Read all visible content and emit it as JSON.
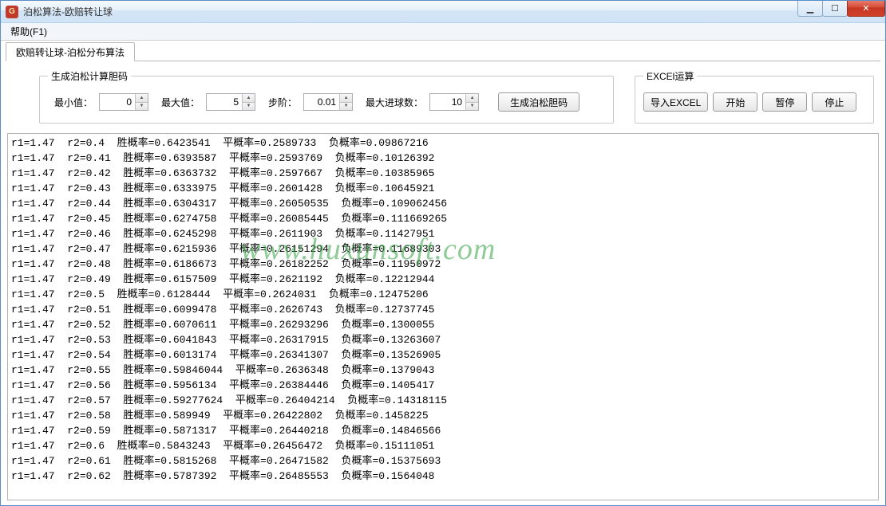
{
  "window": {
    "title": "泊松算法-欧赔转让球",
    "icon_glyph": "G",
    "controls": {
      "minimize": "▁",
      "maximize": "☐",
      "close": "✕"
    }
  },
  "menu": {
    "help": "帮助(F1)"
  },
  "tab": {
    "main": "欧赔转让球-泊松分布算法"
  },
  "gen": {
    "legend": "生成泊松计算胆码",
    "min_label": "最小值：",
    "min_value": "0",
    "max_label": "最大值：",
    "max_value": "5",
    "step_label": "步阶：",
    "step_value": "0.01",
    "maxball_label": "最大进球数：",
    "maxball_value": "10",
    "button": "生成泊松胆码"
  },
  "excel": {
    "legend": "EXCEl运算",
    "import": "导入EXCEL",
    "start": "开始",
    "pause": "暂停",
    "stop": "停止"
  },
  "watermark": "www.huxunsoft.com",
  "chart_data": {
    "type": "table",
    "columns": [
      "r1",
      "r2",
      "胜概率",
      "平概率",
      "负概率"
    ],
    "rows": [
      [
        1.47,
        0.4,
        0.6423541,
        0.2589733,
        0.09867216
      ],
      [
        1.47,
        0.41,
        0.6393587,
        0.2593769,
        0.10126392
      ],
      [
        1.47,
        0.42,
        0.6363732,
        0.2597667,
        0.10385965
      ],
      [
        1.47,
        0.43,
        0.6333975,
        0.2601428,
        0.10645921
      ],
      [
        1.47,
        0.44,
        0.6304317,
        0.26050535,
        0.109062456
      ],
      [
        1.47,
        0.45,
        0.6274758,
        0.26085445,
        0.111669265
      ],
      [
        1.47,
        0.46,
        0.6245298,
        0.2611903,
        0.11427951
      ],
      [
        1.47,
        0.47,
        0.6215936,
        0.26151294,
        0.11689303
      ],
      [
        1.47,
        0.48,
        0.6186673,
        0.26182252,
        0.11950972
      ],
      [
        1.47,
        0.49,
        0.6157509,
        0.2621192,
        0.12212944
      ],
      [
        1.47,
        0.5,
        0.6128444,
        0.2624031,
        0.12475206
      ],
      [
        1.47,
        0.51,
        0.6099478,
        0.2626743,
        0.12737745
      ],
      [
        1.47,
        0.52,
        0.6070611,
        0.26293296,
        0.1300055
      ],
      [
        1.47,
        0.53,
        0.6041843,
        0.26317915,
        0.13263607
      ],
      [
        1.47,
        0.54,
        0.6013174,
        0.26341307,
        0.13526905
      ],
      [
        1.47,
        0.55,
        0.59846044,
        0.2636348,
        0.1379043
      ],
      [
        1.47,
        0.56,
        0.5956134,
        0.26384446,
        0.1405417
      ],
      [
        1.47,
        0.57,
        0.59277624,
        0.26404214,
        0.14318115
      ],
      [
        1.47,
        0.58,
        0.589949,
        0.26422802,
        0.1458225
      ],
      [
        1.47,
        0.59,
        0.5871317,
        0.26440218,
        0.14846566
      ],
      [
        1.47,
        0.6,
        0.5843243,
        0.26456472,
        0.15111051
      ],
      [
        1.47,
        0.61,
        0.5815268,
        0.26471582,
        0.15375693
      ],
      [
        1.47,
        0.62,
        0.5787392,
        0.26485553,
        0.1564048
      ]
    ]
  }
}
